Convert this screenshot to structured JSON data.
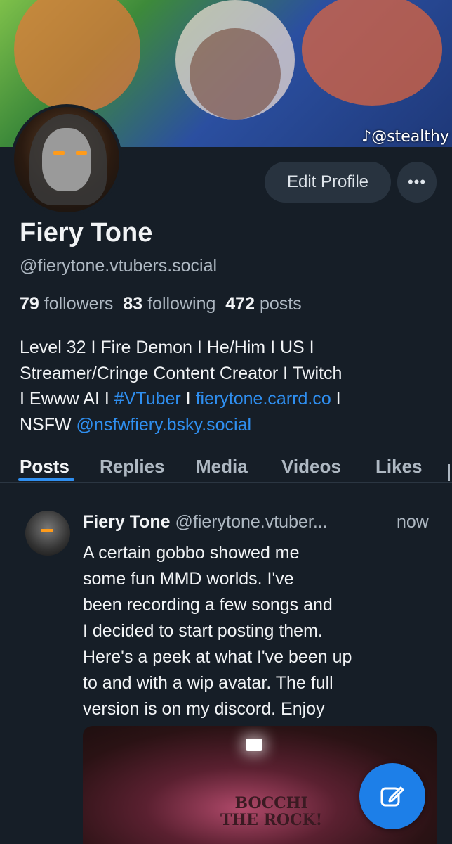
{
  "banner": {
    "watermark": "@stealthy"
  },
  "profile": {
    "edit_label": "Edit Profile",
    "more_label": "•••",
    "name": "Fiery Tone",
    "handle": "@fierytone.vtubers.social",
    "followers_count": "79",
    "followers_label": "followers",
    "following_count": "83",
    "following_label": "following",
    "posts_count": "472",
    "posts_label": "posts",
    "bio": {
      "line1": "Level 32 I Fire Demon I He/Him I US I",
      "line2": "Streamer/Cringe Content Creator I Twitch",
      "line3_a": "I Ewww AI I ",
      "line3_tag": "#VTuber",
      "line3_b": " I ",
      "line3_link": "fierytone.carrd.co",
      "line3_c": " I",
      "line4_a": "NSFW ",
      "line4_mention": "@nsfwfiery.bsky.social"
    }
  },
  "tabs": [
    "Posts",
    "Replies",
    "Media",
    "Videos",
    "Likes"
  ],
  "post": {
    "author_name": "Fiery Tone",
    "author_handle": "@fierytone.vtuber...",
    "time": "now",
    "lines": [
      "A certain gobbo showed me",
      "some fun MMD worlds. I've",
      "been recording a few songs and",
      "I decided to start posting them.",
      "Here's a peek at what I've been up",
      "to and with a wip avatar.  The full",
      "version is on my discord. Enjoy"
    ],
    "media_sign": [
      "BOCCHI",
      "THE ROCK!"
    ]
  },
  "colors": {
    "background": "#161e27",
    "accent": "#2f8ff0",
    "fab": "#1d7fe8"
  },
  "icons": {
    "compose": "compose-icon",
    "more": "more-icon"
  }
}
